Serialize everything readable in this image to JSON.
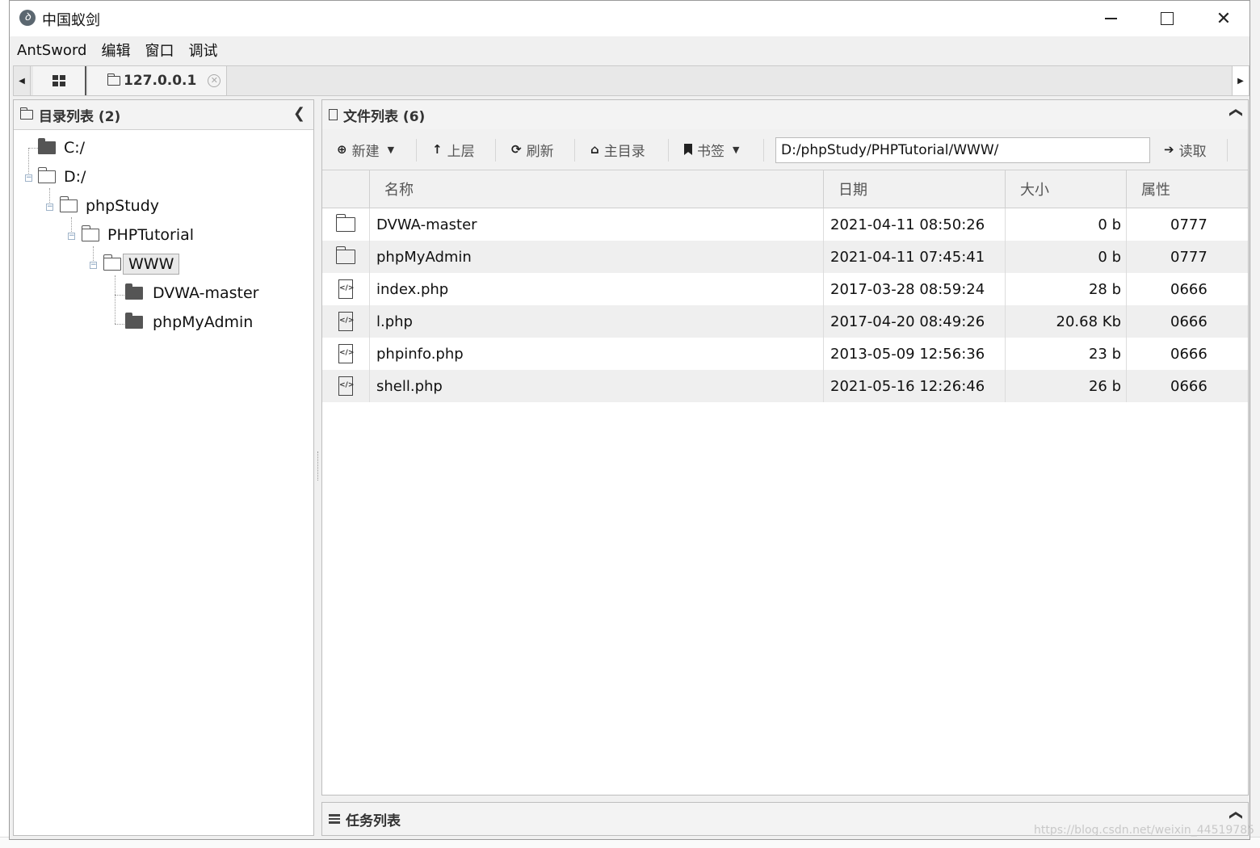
{
  "window": {
    "title": "中国蚁剑",
    "app_icon_glyph": "ꝺ",
    "controls": {
      "minimize": "minimize",
      "maximize": "maximize",
      "close": "✕"
    }
  },
  "menubar": [
    "AntSword",
    "编辑",
    "窗口",
    "调试"
  ],
  "tabs": {
    "left_arrow": "◀",
    "right_arrow": "▶",
    "host_label": "127.0.0.1",
    "close_glyph": "✕"
  },
  "left_panel": {
    "title": "目录列表 (2)",
    "collapse_glyph": "❮",
    "tree": [
      {
        "label": "C:/",
        "depth": 0,
        "icon": "folder-filled"
      },
      {
        "label": "D:/",
        "depth": 0,
        "icon": "folder-open"
      },
      {
        "label": "phpStudy",
        "depth": 1,
        "icon": "folder-open"
      },
      {
        "label": "PHPTutorial",
        "depth": 2,
        "icon": "folder-open"
      },
      {
        "label": "WWW",
        "depth": 3,
        "icon": "folder-open",
        "selected": true
      },
      {
        "label": "DVWA-master",
        "depth": 4,
        "icon": "folder-filled"
      },
      {
        "label": "phpMyAdmin",
        "depth": 4,
        "icon": "folder-filled"
      }
    ]
  },
  "right_panel": {
    "title": "文件列表 (6)",
    "collapse_glyph": "❯",
    "toolbar": {
      "new_label": "新建",
      "up_label": "上层",
      "refresh_label": "刷新",
      "home_label": "主目录",
      "bookmark_label": "书签",
      "path_value": "D:/phpStudy/PHPTutorial/WWW/",
      "read_label": "读取",
      "icons": {
        "new": "⊕",
        "up": "🡅",
        "refresh": "⟳",
        "home": "⌂",
        "bookmark": "🔖",
        "read": "➔",
        "caret": "▼"
      }
    },
    "columns": [
      "名称",
      "日期",
      "大小",
      "属性"
    ],
    "files": [
      {
        "type": "folder",
        "name": "DVWA-master",
        "date": "2021-04-11 08:50:26",
        "size": "0 b",
        "attr": "0777"
      },
      {
        "type": "folder",
        "name": "phpMyAdmin",
        "date": "2021-04-11 07:45:41",
        "size": "0 b",
        "attr": "0777"
      },
      {
        "type": "file",
        "name": "index.php",
        "date": "2017-03-28 08:59:24",
        "size": "28 b",
        "attr": "0666"
      },
      {
        "type": "file",
        "name": "l.php",
        "date": "2017-04-20 08:49:26",
        "size": "20.68 Kb",
        "attr": "0666"
      },
      {
        "type": "file",
        "name": "phpinfo.php",
        "date": "2013-05-09 12:56:36",
        "size": "23 b",
        "attr": "0666"
      },
      {
        "type": "file",
        "name": "shell.php",
        "date": "2021-05-16 12:26:46",
        "size": "26 b",
        "attr": "0666"
      }
    ]
  },
  "task_panel": {
    "title": "任务列表",
    "collapse_glyph": "❯"
  },
  "watermark": "https://blog.csdn.net/weixin_44519785"
}
